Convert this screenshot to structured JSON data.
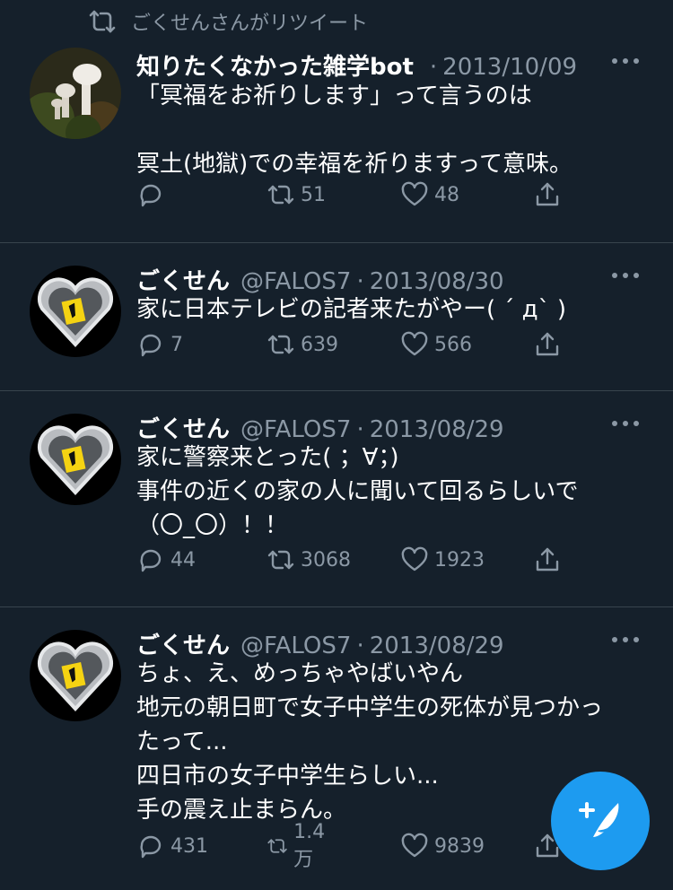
{
  "retweet_banner": {
    "text": "ごくせんさんがリツイート",
    "icon": "retweet-icon"
  },
  "tweets": [
    {
      "name": "知りたくなかった雑学bot",
      "handle": "",
      "date": "2013/10/09",
      "avatar": "mushroom-photo",
      "text": "「冥福をお祈りします」って言うのは\n\n冥土(地獄)での幸福を祈りますって意味。",
      "reply_count": "",
      "retweet_count": "51",
      "like_count": "48"
    },
    {
      "name": "ごくせん",
      "handle": "@FALOS7",
      "date": "2013/08/30",
      "avatar": "ferrari-heart",
      "text": "家に日本テレビの記者来たがやー( ´ д` )",
      "reply_count": "7",
      "retweet_count": "639",
      "like_count": "566"
    },
    {
      "name": "ごくせん",
      "handle": "@FALOS7",
      "date": "2013/08/29",
      "avatar": "ferrari-heart",
      "text": "家に警察来とった( ；∀；)\n事件の近くの家の人に聞いて回るらしいで\n（〇_〇）！！",
      "reply_count": "44",
      "retweet_count": "3068",
      "like_count": "1923"
    },
    {
      "name": "ごくせん",
      "handle": "@FALOS7",
      "date": "2013/08/29",
      "avatar": "ferrari-heart",
      "text": "ちょ、え、めっちゃやばいやん\n地元の朝日町で女子中学生の死体が見つかっ\nたって...\n四日市の女子中学生らしい...\n手の震え止まらん。",
      "reply_count": "431",
      "retweet_count": "1.4万",
      "like_count": "9839"
    }
  ],
  "fab": {
    "icon": "compose-tweet-icon",
    "color": "#1d9bf0"
  },
  "colors": {
    "background": "#15202b",
    "secondary_text": "#8b98a5",
    "divider": "#38444d"
  }
}
